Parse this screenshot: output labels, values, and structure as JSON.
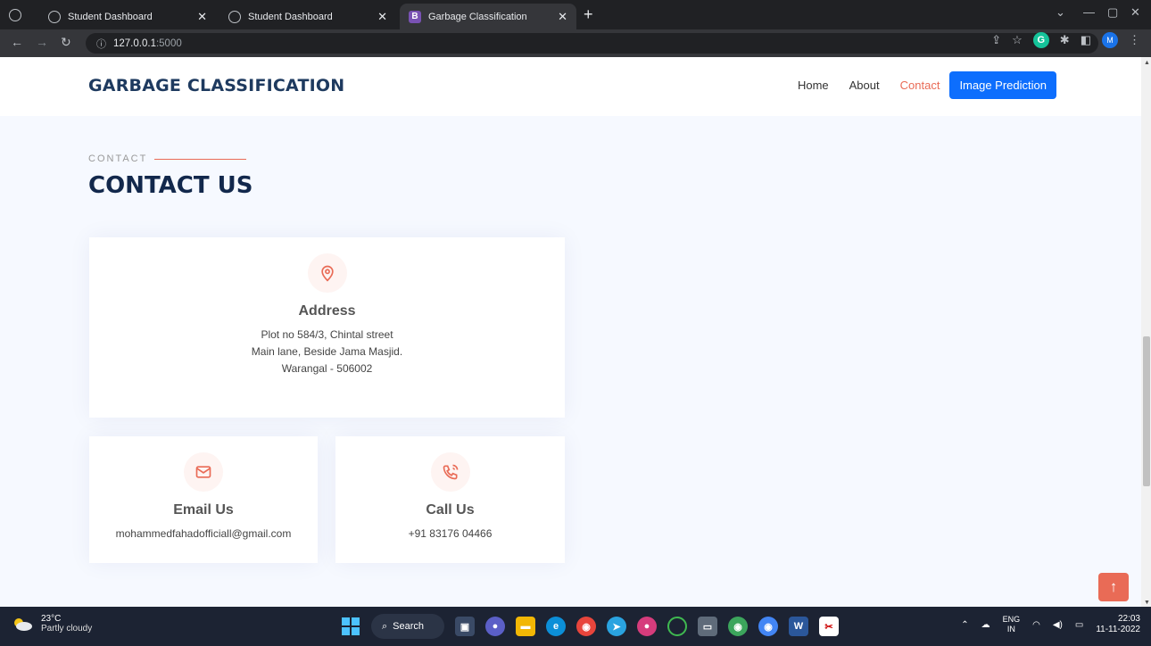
{
  "browser": {
    "tabs": [
      {
        "title": "Student Dashboard",
        "active": false
      },
      {
        "title": "Student Dashboard",
        "active": false
      },
      {
        "title": "Garbage Classification",
        "active": true
      }
    ],
    "url_host": "127.0.0.1",
    "url_port": ":5000",
    "profile_initial": "M"
  },
  "site": {
    "logo": "GARBAGE CLASSIFICATION",
    "nav": {
      "home": "Home",
      "about": "About",
      "contact": "Contact",
      "cta": "Image Prediction"
    },
    "accent": "#e96b56",
    "primary": "#0d6efd",
    "heading_color": "#12284c"
  },
  "contact": {
    "eyebrow": "CONTACT",
    "title": "CONTACT US",
    "address": {
      "heading": "Address",
      "line1": "Plot no 584/3, Chintal street",
      "line2": "Main lane, Beside Jama Masjid.",
      "line3": "Warangal - 506002"
    },
    "email": {
      "heading": "Email Us",
      "value": "mohammedfahadofficiall@gmail.com"
    },
    "phone": {
      "heading": "Call Us",
      "value": "+91 83176 04466"
    }
  },
  "taskbar": {
    "temp": "23°C",
    "weather": "Partly cloudy",
    "search": "Search",
    "lang1": "ENG",
    "lang2": "IN",
    "time": "22:03",
    "date": "11-11-2022"
  }
}
